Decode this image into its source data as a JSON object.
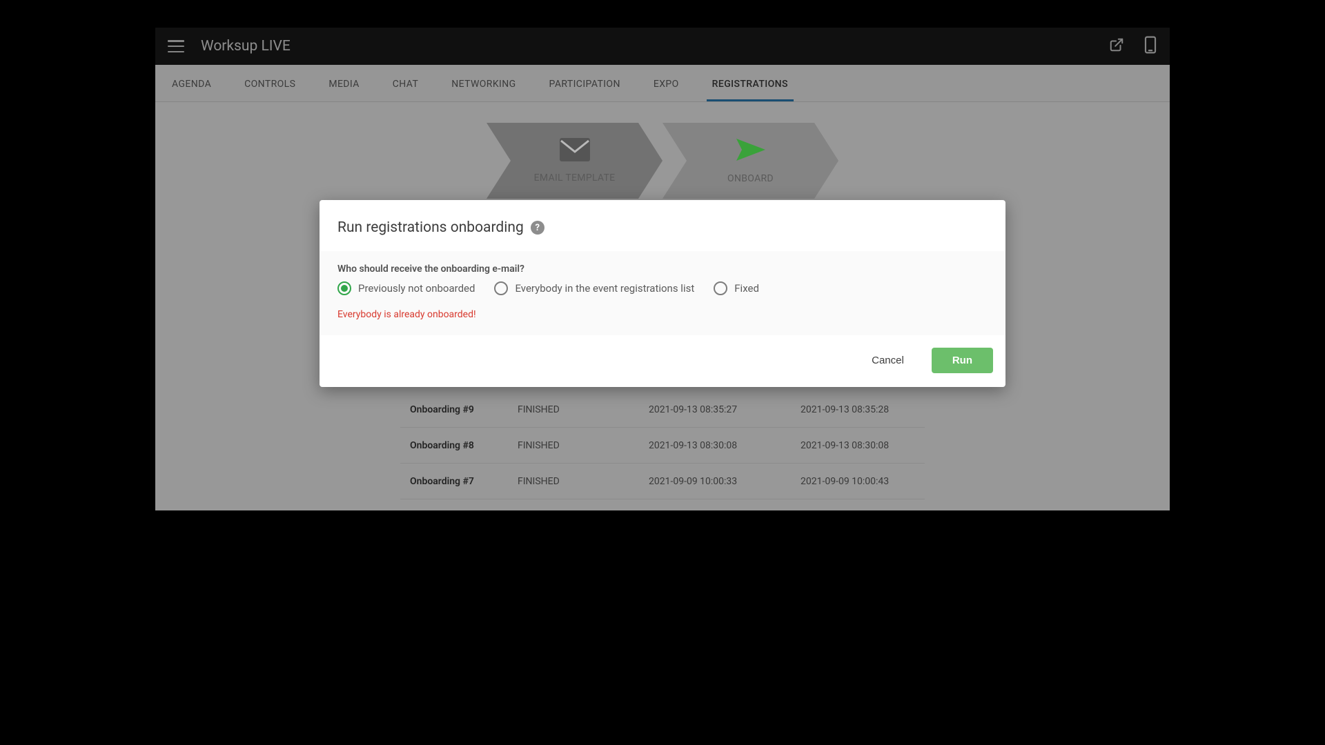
{
  "header": {
    "app_title": "Worksup LIVE"
  },
  "tabs": {
    "items": [
      {
        "label": "AGENDA"
      },
      {
        "label": "CONTROLS"
      },
      {
        "label": "MEDIA"
      },
      {
        "label": "CHAT"
      },
      {
        "label": "NETWORKING"
      },
      {
        "label": "PARTICIPATION"
      },
      {
        "label": "EXPO"
      },
      {
        "label": "REGISTRATIONS"
      }
    ],
    "active_index": 7
  },
  "steps": {
    "items": [
      {
        "label": "EMAIL TEMPLATE",
        "icon": "mail-icon",
        "active": false
      },
      {
        "label": "ONBOARD",
        "icon": "send-icon",
        "active": true
      }
    ]
  },
  "table": {
    "rows": [
      {
        "name": "Onboarding #9",
        "status": "FINISHED",
        "started": "2021-09-13 08:35:27",
        "finished": "2021-09-13 08:35:28"
      },
      {
        "name": "Onboarding #8",
        "status": "FINISHED",
        "started": "2021-09-13 08:30:08",
        "finished": "2021-09-13 08:30:08"
      },
      {
        "name": "Onboarding #7",
        "status": "FINISHED",
        "started": "2021-09-09 10:00:33",
        "finished": "2021-09-09 10:00:43"
      }
    ]
  },
  "modal": {
    "title": "Run registrations onboarding",
    "help_glyph": "?",
    "question": "Who should receive the onboarding e-mail?",
    "options": [
      {
        "label": "Previously not onboarded",
        "selected": true
      },
      {
        "label": "Everybody in the event registrations list",
        "selected": false
      },
      {
        "label": "Fixed",
        "selected": false
      }
    ],
    "error": "Everybody is already onboarded!",
    "cancel_label": "Cancel",
    "run_label": "Run"
  }
}
